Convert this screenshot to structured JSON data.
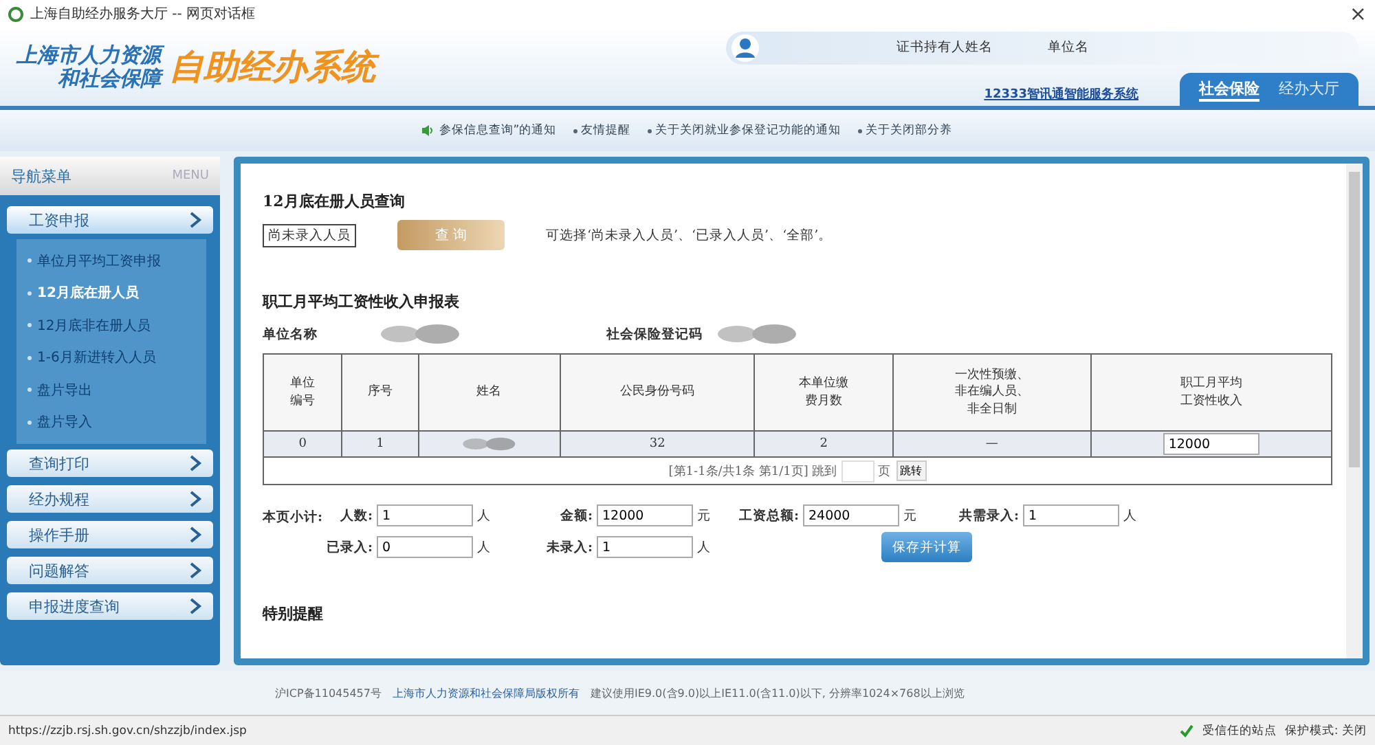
{
  "window": {
    "title": "上海自助经办服务大厅 -- 网页对话框",
    "close": "×"
  },
  "header": {
    "logo_line1": "上海市人力资源",
    "logo_line2": "和社会保障",
    "system_name": "自助经办系统",
    "holder_label": "证书持有人姓名",
    "unit_label": "单位名",
    "service_link": "12333智讯通智能服务系统",
    "tabs": [
      {
        "label": "社会保险",
        "selected": true
      },
      {
        "label": "经办大厅",
        "selected": false
      }
    ]
  },
  "notices": [
    "参保信息查询”的通知",
    "友情提醒",
    "关于关闭就业参保登记功能的通知",
    "关于关闭部分养"
  ],
  "nav": {
    "title": "导航菜单",
    "menu_label": "MENU",
    "items": [
      {
        "label": "工资申报",
        "expanded": true,
        "children": [
          {
            "label": "单位月平均工资申报",
            "selected": false
          },
          {
            "label": "12月底在册人员",
            "selected": true
          },
          {
            "label": "12月底非在册人员",
            "selected": false
          },
          {
            "label": "1-6月新进转入人员",
            "selected": false
          },
          {
            "label": "盘片导出",
            "selected": false
          },
          {
            "label": "盘片导入",
            "selected": false
          }
        ]
      },
      {
        "label": "查询打印",
        "expanded": false
      },
      {
        "label": "经办规程",
        "expanded": false
      },
      {
        "label": "操作手册",
        "expanded": false
      },
      {
        "label": "问题解答",
        "expanded": false
      },
      {
        "label": "申报进度查询",
        "expanded": false
      }
    ]
  },
  "query": {
    "title": "12月底在册人员查询",
    "select_value": "尚未录入人员",
    "button": "查 询",
    "hint": "可选择‘尚未录入人员’、‘已录入人员’、‘全部’。"
  },
  "report": {
    "title": "职工月平均工资性收入申报表",
    "unit_label": "单位名称",
    "reg_label": "社会保险登记码",
    "columns": [
      "单位编号",
      "序号",
      "姓名",
      "公民身份号码",
      "本单位缴费月数",
      "一次性预缴、非在编人员、非全日制",
      "职工月平均工资性收入"
    ],
    "rows": [
      {
        "unit_no": "0",
        "seq": "1",
        "id_prefix": "32",
        "months": "2",
        "one_time": "—",
        "income": "12000"
      }
    ],
    "pager": {
      "info": "[第1-1条/共1条 第1/1页] 跳到",
      "page_unit": "页",
      "jump": "跳转"
    }
  },
  "subtotal": {
    "label": "本页小计:",
    "rows": [
      [
        {
          "label": "人数:",
          "value": "1",
          "unit": "人"
        },
        {
          "label": "金额:",
          "value": "12000",
          "unit": "元"
        },
        {
          "label": "工资总额:",
          "value": "24000",
          "unit": "元"
        },
        {
          "label": "共需录入:",
          "value": "1",
          "unit": "人"
        }
      ],
      [
        {
          "label": "已录入:",
          "value": "0",
          "unit": "人"
        },
        {
          "label": "未录入:",
          "value": "1",
          "unit": "人"
        }
      ]
    ],
    "save_button": "保存并计算"
  },
  "notice_title": "特别提醒",
  "footer": {
    "icp": "沪ICP备11045457号",
    "copyright": "上海市人力资源和社会保障局版权所有",
    "suggestion": "建议使用IE9.0(含9.0)以上IE11.0(含11.0)以下, 分辨率1024×768以上浏览"
  },
  "status_bar": {
    "url": "https://zzjb.rsj.sh.gov.cn/shzzjb/index.jsp",
    "zone": "受信任的站点",
    "mode": "保护模式: 关闭"
  }
}
